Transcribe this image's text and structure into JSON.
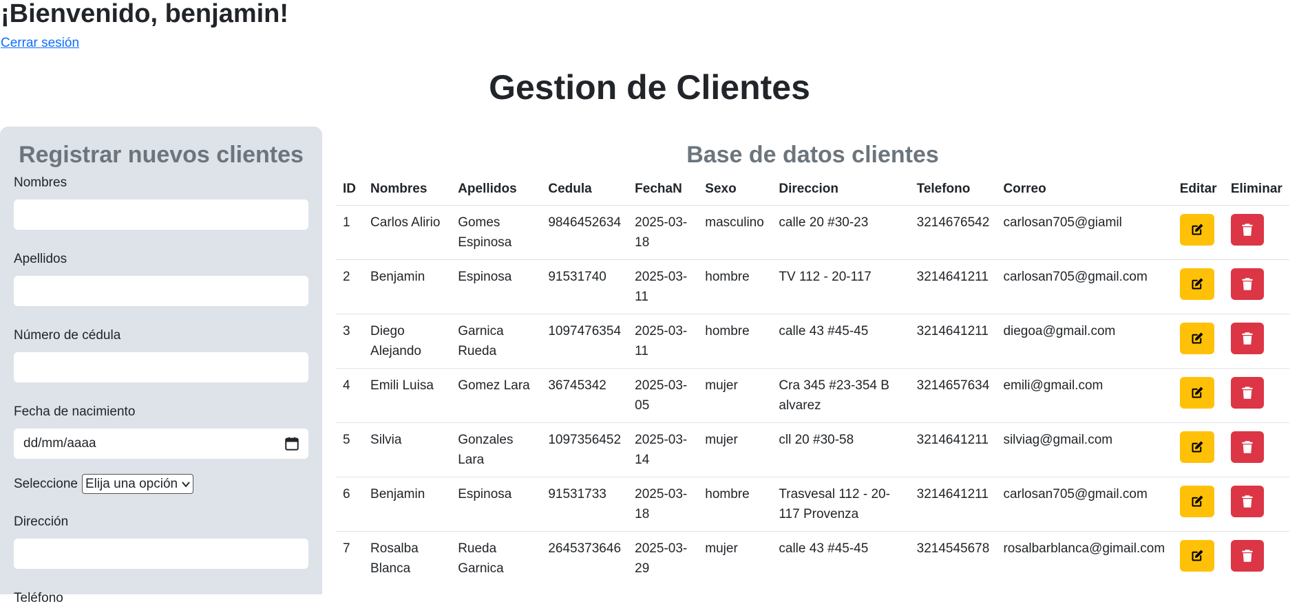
{
  "header": {
    "welcome": "¡Bienvenido, benjamin!",
    "logout": "Cerrar sesión",
    "title": "Gestion de Clientes"
  },
  "form": {
    "title": "Registrar nuevos clientes",
    "nombres_label": "Nombres",
    "apellidos_label": "Apellidos",
    "cedula_label": "Número de cédula",
    "fecha_label": "Fecha de nacimiento",
    "fecha_placeholder": "dd/mm/aaaa",
    "select_label": "Seleccione",
    "select_value": "Elija una opción",
    "direccion_label": "Dirección",
    "telefono_label": "Teléfono"
  },
  "table": {
    "title": "Base de datos clientes",
    "headers": [
      "ID",
      "Nombres",
      "Apellidos",
      "Cedula",
      "FechaN",
      "Sexo",
      "Direccion",
      "Telefono",
      "Correo",
      "Editar",
      "Eliminar"
    ],
    "rows": [
      [
        "1",
        "Carlos Alirio",
        "Gomes Espinosa",
        "9846452634",
        "2025-03-18",
        "masculino",
        "calle 20 #30-23",
        "3214676542",
        "carlosan705@giamil"
      ],
      [
        "2",
        "Benjamin",
        "Espinosa",
        "91531740",
        "2025-03-11",
        "hombre",
        "TV 112 - 20-117",
        "3214641211",
        "carlosan705@gmail.com"
      ],
      [
        "3",
        "Diego Alejando",
        "Garnica Rueda",
        "1097476354",
        "2025-03-11",
        "hombre",
        "calle 43 #45-45",
        "3214641211",
        "diegoa@gmail.com"
      ],
      [
        "4",
        "Emili Luisa",
        "Gomez Lara",
        "36745342",
        "2025-03-05",
        "mujer",
        "Cra 345 #23-354 B alvarez",
        "3214657634",
        "emili@gmail.com"
      ],
      [
        "5",
        "Silvia",
        "Gonzales Lara",
        "1097356452",
        "2025-03-14",
        "mujer",
        "cll 20 #30-58",
        "3214641211",
        "silviag@gmail.com"
      ],
      [
        "6",
        "Benjamin",
        "Espinosa",
        "91531733",
        "2025-03-18",
        "hombre",
        "Trasvesal 112 - 20-117 Provenza",
        "3214641211",
        "carlosan705@gmail.com"
      ],
      [
        "7",
        "Rosalba Blanca",
        "Rueda Garnica",
        "2645373646",
        "2025-03-29",
        "mujer",
        "calle 43 #45-45",
        "3214545678",
        "rosalbarblanca@gimail.com"
      ]
    ]
  },
  "colors": {
    "edit": "#ffc107",
    "delete": "#dc3545",
    "panel": "#dee2e9",
    "link": "#0d6efd"
  },
  "icons": {
    "edit": "pencil-square-icon",
    "delete": "trash-icon",
    "calendar": "calendar-icon"
  }
}
